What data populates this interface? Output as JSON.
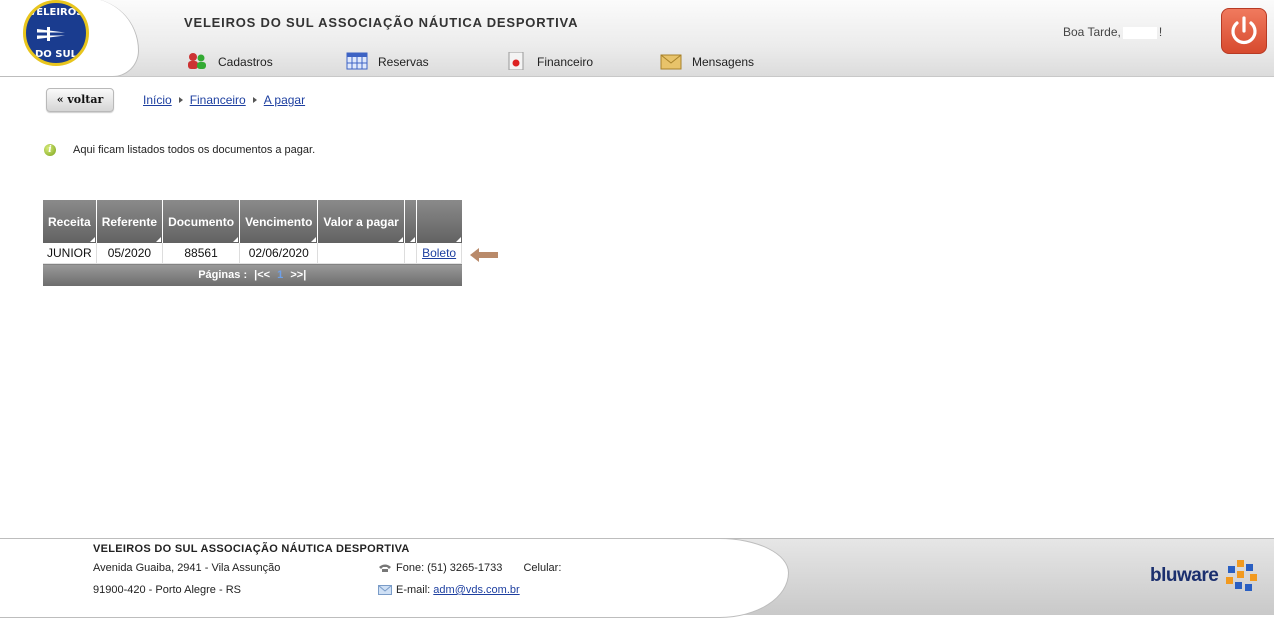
{
  "header": {
    "logo_text_top": "VELEIROS",
    "logo_text_bottom": "DO SUL",
    "org_title": "VELEIROS DO SUL ASSOCIAÇÃO NÁUTICA DESPORTIVA",
    "greeting_prefix": "Boa Tarde,",
    "greeting_suffix": "!",
    "nav": [
      {
        "label": "Cadastros",
        "icon": "people-icon"
      },
      {
        "label": "Reservas",
        "icon": "calendar-icon"
      },
      {
        "label": "Financeiro",
        "icon": "document-icon"
      },
      {
        "label": "Mensagens",
        "icon": "envelope-icon"
      }
    ],
    "power_icon": "power-icon",
    "colors": {
      "power": "#e55a3c",
      "link": "#1d3fa0",
      "logo_blue": "#1a3c8f",
      "logo_gold": "#e8c51d"
    }
  },
  "toolbar": {
    "back_label": "« voltar",
    "breadcrumb": [
      "Início",
      "Financeiro",
      "A pagar"
    ]
  },
  "info": {
    "message": "Aqui ficam listados todos os documentos a pagar.",
    "icon": "info-icon"
  },
  "table": {
    "columns": [
      "Receita",
      "Referente",
      "Documento",
      "Vencimento",
      "Valor a pagar",
      "",
      ""
    ],
    "rows": [
      {
        "receita": "JUNIOR",
        "referente": "05/2020",
        "documento": "88561",
        "vencimento": "02/06/2020",
        "valor": "",
        "extra": "",
        "acao": "Boleto"
      }
    ],
    "pager": {
      "label": "Páginas :",
      "first": "|<<",
      "current": "1",
      "last": ">>|"
    }
  },
  "footer": {
    "title": "VELEIROS DO SUL ASSOCIAÇÃO NÁUTICA DESPORTIVA",
    "address": "Avenida Guaiba, 2941 - Vila Assunção",
    "cep": "91900-420 - Porto Alegre - RS",
    "phone": "Fone: (51) 3265-1733",
    "mobile": "Celular:",
    "email_label": "E-mail:",
    "email": "adm@vds.com.br",
    "brand": "bluware"
  }
}
